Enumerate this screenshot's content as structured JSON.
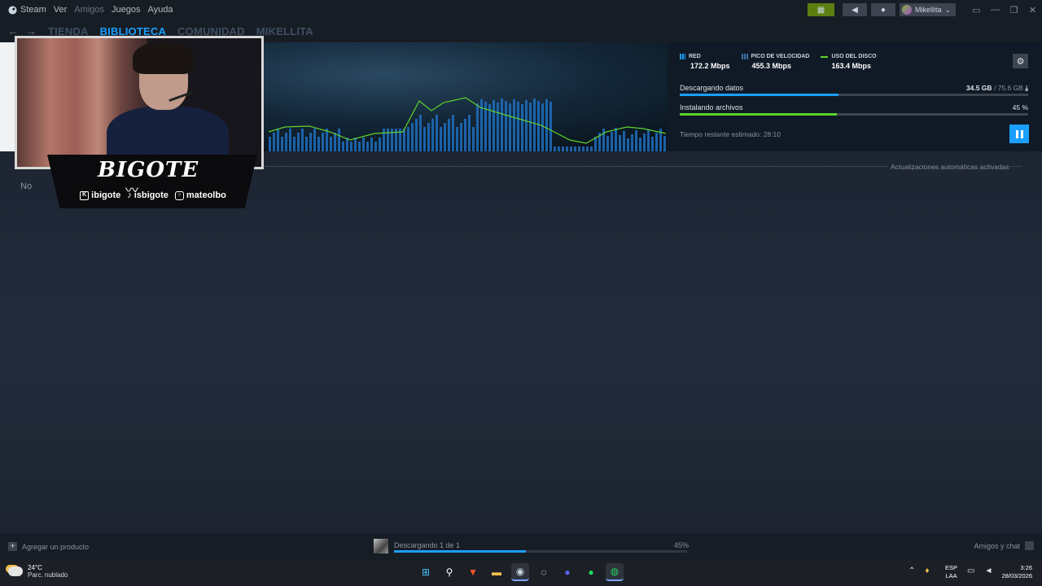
{
  "menu": {
    "app_name": "Steam",
    "items": [
      "Ver",
      "Amigos",
      "Juegos",
      "Ayuda"
    ]
  },
  "account": {
    "name": "Mikellita"
  },
  "nav": {
    "tabs": [
      "TIENDA",
      "BIBLIOTECA",
      "COMUNIDAD",
      "MIKELLITA"
    ],
    "active_tab": "BIBLIOTECA"
  },
  "downloads": {
    "stats": [
      {
        "label": "RED",
        "value": "172.2 Mbps"
      },
      {
        "label": "PICO DE VELOCIDAD",
        "value": "455.3 Mbps"
      },
      {
        "label": "USO DEL DISCO",
        "value": "163.4 Mbps"
      }
    ],
    "downloading_label": "Descargando datos",
    "downloaded": "34.5 GB",
    "total_sep": "/ 75.6 GB",
    "download_fraction": 0.456,
    "installing_label": "Instalando archivos",
    "install_percent_text": "45 %",
    "install_fraction": 0.45,
    "eta_label": "Tiempo restante estimado:",
    "eta_value": "28:10",
    "auto_updates": "Actualizaciones automáticas activadas",
    "queue_partial_label": "No"
  },
  "overlay": {
    "brand": "BIGOTE",
    "socials": [
      {
        "icon": "twitch-kick-icon",
        "handle": "ibigote"
      },
      {
        "icon": "tiktok-icon",
        "handle": "isbigote"
      },
      {
        "icon": "instagram-icon",
        "handle": "mateolbo"
      }
    ]
  },
  "statusbar": {
    "add_product": "Agregar un producto",
    "download_status": "Descargando 1 de 1",
    "download_percent": "45%",
    "download_fraction": 0.45,
    "friends_chat": "Amigos y chat"
  },
  "taskbar": {
    "temp": "24°C",
    "weather": "Parc. nublado",
    "lang_line1": "ESP",
    "lang_line2": "LAA",
    "time": "3:26",
    "date": "28/03/2026"
  },
  "colors": {
    "accent": "#1a9fff",
    "disk_line": "#5fd32b",
    "background": "#1b2434"
  }
}
